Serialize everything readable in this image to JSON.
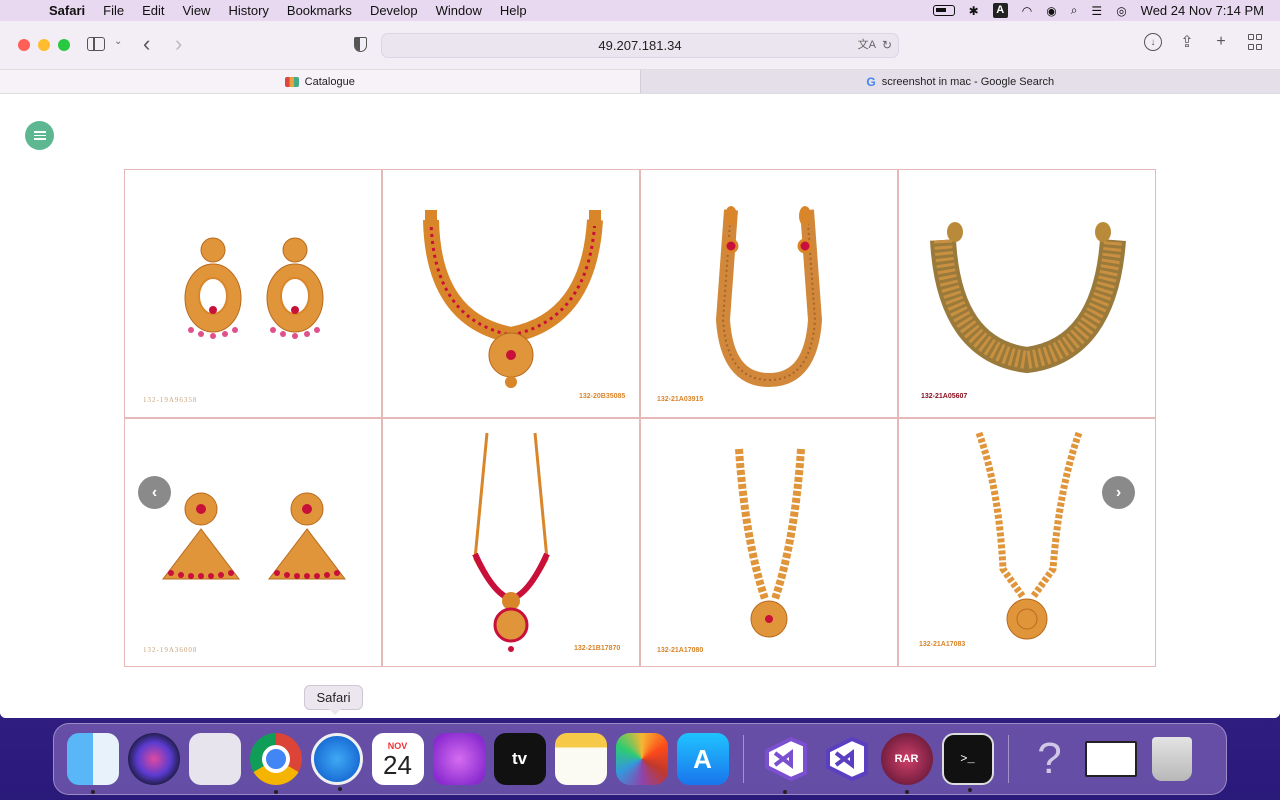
{
  "menubar": {
    "app_name": "Safari",
    "items": [
      "File",
      "Edit",
      "View",
      "History",
      "Bookmarks",
      "Develop",
      "Window",
      "Help"
    ],
    "status": {
      "datetime": "Wed 24 Nov  7:14 PM",
      "input_source": "A"
    }
  },
  "toolbar": {
    "url": "49.207.181.34"
  },
  "tabs": [
    {
      "title": "Catalogue",
      "active": true
    },
    {
      "title": "screenshot in mac - Google Search",
      "active": false
    }
  ],
  "catalog": {
    "items": [
      {
        "sku": "132-19A96358",
        "kind": "earrings"
      },
      {
        "sku": "132-20B35085",
        "kind": "necklace"
      },
      {
        "sku": "132-21A03915",
        "kind": "long-chain"
      },
      {
        "sku": "132-21A05607",
        "kind": "necklace"
      },
      {
        "sku": "132-19A36008",
        "kind": "jhumka"
      },
      {
        "sku": "132-21B17870",
        "kind": "pendant-chain"
      },
      {
        "sku": "132-21A17080",
        "kind": "pendant-chain"
      },
      {
        "sku": "132-21A17083",
        "kind": "pendant-chain"
      }
    ],
    "prev_label": "‹",
    "next_label": "›"
  },
  "dock": {
    "tooltip": "Safari",
    "calendar": {
      "month": "NOV",
      "day": "24"
    },
    "tv_label": "tv",
    "terminal_label": ">_",
    "rar_label": "RAR",
    "help_label": "?"
  },
  "colors": {
    "gold": "#d9852a",
    "ruby": "#c8103a",
    "card_border": "#e6b9b9",
    "menu_fab": "#5db892"
  }
}
